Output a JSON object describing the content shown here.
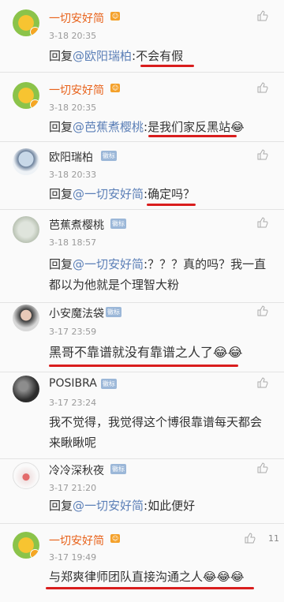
{
  "comments": [
    {
      "username": "一切安好简",
      "time": "3-18 20:35",
      "reply_prefix": "回复",
      "mention": "@欧阳瑞柏",
      "text": ":不会有假"
    },
    {
      "username": "一切安好简",
      "time": "3-18 20:35",
      "reply_prefix": "回复",
      "mention": "@芭蕉煮樱桃",
      "text": ":是我们家反黑站😂"
    },
    {
      "username": "欧阳瑞柏",
      "time": "3-18 20:33",
      "reply_prefix": "回复",
      "mention": "@一切安好简",
      "text": ":确定吗？"
    },
    {
      "username": "芭蕉煮樱桃",
      "time": "3-18 18:57",
      "reply_prefix": "回复",
      "mention": "@一切安好简",
      "text": ":？？？真的吗？我一直都以为他就是个理智大粉"
    },
    {
      "username": "小安魔法袋",
      "time": "3-17 23:59",
      "text": "黑哥不靠谱就没有靠谱之人了😂😂"
    },
    {
      "username": "POSIBRA",
      "time": "3-17 23:24",
      "text": "我不觉得，我觉得这个博很靠谱每天都会来瞅瞅呢"
    },
    {
      "username": "冷冷深秋夜",
      "time": "3-17 21:20",
      "reply_prefix": "回复",
      "mention": "@一切安好简",
      "text": ":如此便好"
    },
    {
      "username": "一切安好简",
      "time": "3-17 19:49",
      "text": "与郑爽律师团队直接沟通之人😂😂😂",
      "likes": "11"
    }
  ]
}
